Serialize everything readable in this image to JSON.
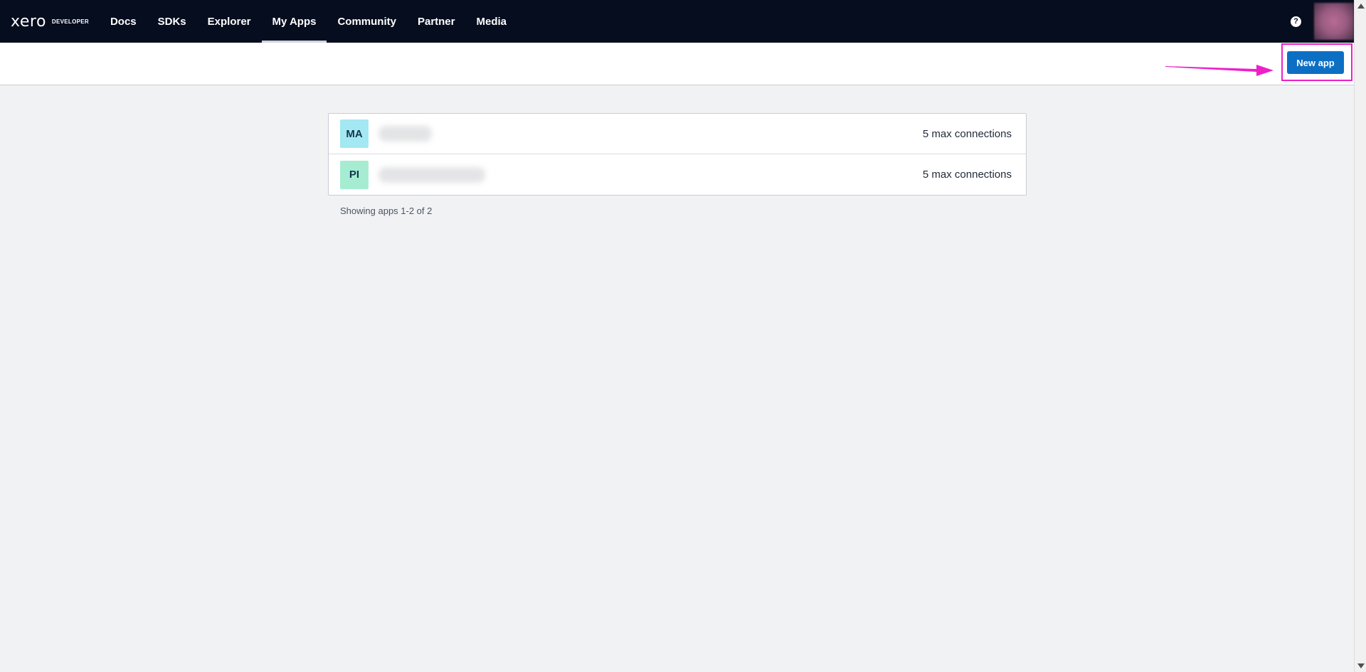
{
  "brand": {
    "name": "xero",
    "sub": "DEVELOPER"
  },
  "nav": {
    "items": [
      {
        "label": "Docs"
      },
      {
        "label": "SDKs"
      },
      {
        "label": "Explorer"
      },
      {
        "label": "My Apps"
      },
      {
        "label": "Community"
      },
      {
        "label": "Partner"
      },
      {
        "label": "Media"
      }
    ],
    "active": "My Apps",
    "help_glyph": "?"
  },
  "toolbar": {
    "new_app_label": "New app",
    "highlight_color": "#ee1fc9",
    "button_color": "#0d6fc4"
  },
  "apps": [
    {
      "initials": "MA",
      "badge_color": "#a3e8f3",
      "name_redacted": true,
      "connections": "5 max connections"
    },
    {
      "initials": "PI",
      "badge_color": "#a6ecd2",
      "name_redacted": true,
      "connections": "5 max connections"
    }
  ],
  "footer": {
    "showing": "Showing apps 1-2 of 2"
  },
  "icons": [
    "help-icon",
    "arrow-annotation-icon",
    "scroll-up-icon",
    "scroll-down-icon"
  ]
}
